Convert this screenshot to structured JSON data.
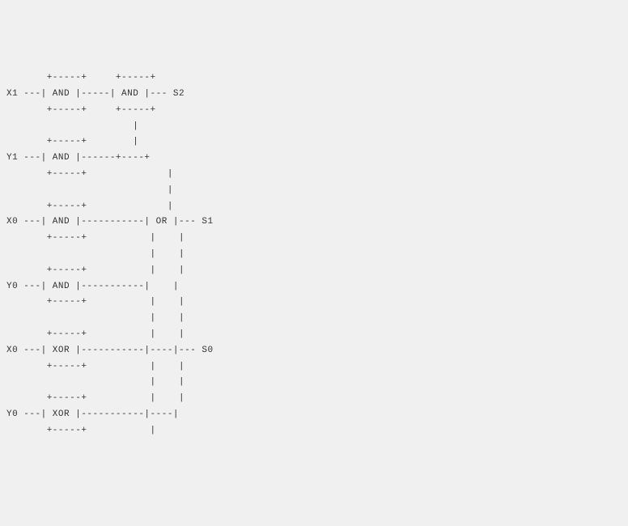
{
  "circuit": {
    "inputs": [
      "X1",
      "Y1",
      "X0",
      "Y0",
      "X0",
      "Y0"
    ],
    "gates": [
      "AND",
      "AND",
      "AND",
      "AND",
      "AND",
      "XOR",
      "XOR",
      "OR"
    ],
    "outputs": [
      "S2",
      "S1",
      "S0"
    ],
    "lines": [
      "       +-----+     +-----+",
      "X1 ---| AND |-----| AND |--- S2",
      "       +-----+     +-----+",
      "                      |",
      "       +-----+        |",
      "Y1 ---| AND |------+----+",
      "       +-----+              |",
      "                            |",
      "       +-----+              |",
      "X0 ---| AND |-----------| OR |--- S1",
      "       +-----+           |    |",
      "                         |    |",
      "       +-----+           |    |",
      "Y0 ---| AND |-----------|    |",
      "       +-----+           |    |",
      "                         |    |",
      "       +-----+           |    |",
      "X0 ---| XOR |-----------|----|--- S0",
      "       +-----+           |    |",
      "                         |    |",
      "       +-----+           |    |",
      "Y0 ---| XOR |-----------|----|",
      "       +-----+           |"
    ]
  }
}
